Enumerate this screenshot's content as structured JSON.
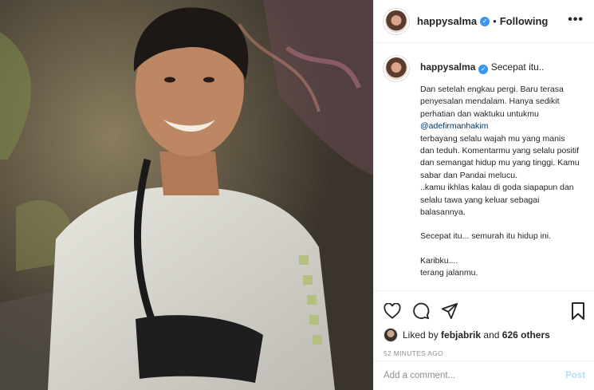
{
  "post": {
    "username": "happysalma",
    "separator": "•",
    "follow_status": "Following",
    "more_label": "•••"
  },
  "caption": {
    "username": "happysalma",
    "first_line": "Secepat itu..",
    "lines": [
      "Dan setelah engkau pergi. Baru terasa penyesalan mendalam. Hanya sedikit perhatian dan waktuku untukmu",
      "@adefirmanhakim",
      "terbayang selalu wajah mu yang manis dan teduh. Komentarmu yang selalu positif dan semangat hidup mu yang tinggi. Kamu sabar dan Pandai melucu.",
      "..kamu ikhlas kalau di goda siapapun dan selalu tawa yang keluar sebagai balasannya.",
      "Secepat itu... semurah itu hidup ini.",
      "Karibku....",
      "terang jalanmu."
    ]
  },
  "likes": {
    "prefix": "Liked by",
    "user": "febjabrik",
    "joiner": "and",
    "others": "626 others"
  },
  "timestamp": "52 MINUTES AGO",
  "comment": {
    "placeholder": "Add a comment...",
    "post_label": "Post"
  },
  "icons": {
    "like": "heart-icon",
    "comment": "comment-icon",
    "share": "share-icon",
    "save": "bookmark-icon",
    "verified": "verified-badge-icon"
  },
  "colors": {
    "verified": "#3897f0",
    "mention": "#00376b",
    "post_button_disabled": "#b2dffc",
    "muted": "#8e8e8e"
  }
}
